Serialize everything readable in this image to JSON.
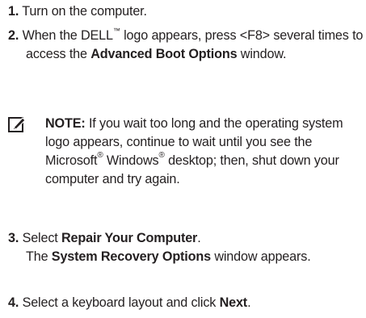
{
  "steps": {
    "s1": {
      "num": "1.",
      "text": "Turn on the computer."
    },
    "s2": {
      "num": "2.",
      "pre": "When the DELL",
      "tm": "™",
      "mid": " logo appears, press <F8> several times to access the ",
      "bold": "Advanced Boot Options",
      "post": " window."
    },
    "s3": {
      "num": "3.",
      "pre": "Select ",
      "bold": "Repair Your Computer",
      "post": ".",
      "line2_pre": "The ",
      "line2_bold": "System Recovery Options",
      "line2_post": " window appears."
    },
    "s4": {
      "num": "4.",
      "pre": "Select a keyboard layout and click ",
      "bold": "Next",
      "post": "."
    }
  },
  "note": {
    "icon": "pencil-note-icon",
    "label": "NOTE:",
    "text1": " If you wait too long and the operating system logo appears, continue to wait until you see the Microsoft",
    "reg1": "®",
    "text2": " Windows",
    "reg2": "®",
    "text3": " desktop; then, shut down your computer and try again."
  }
}
